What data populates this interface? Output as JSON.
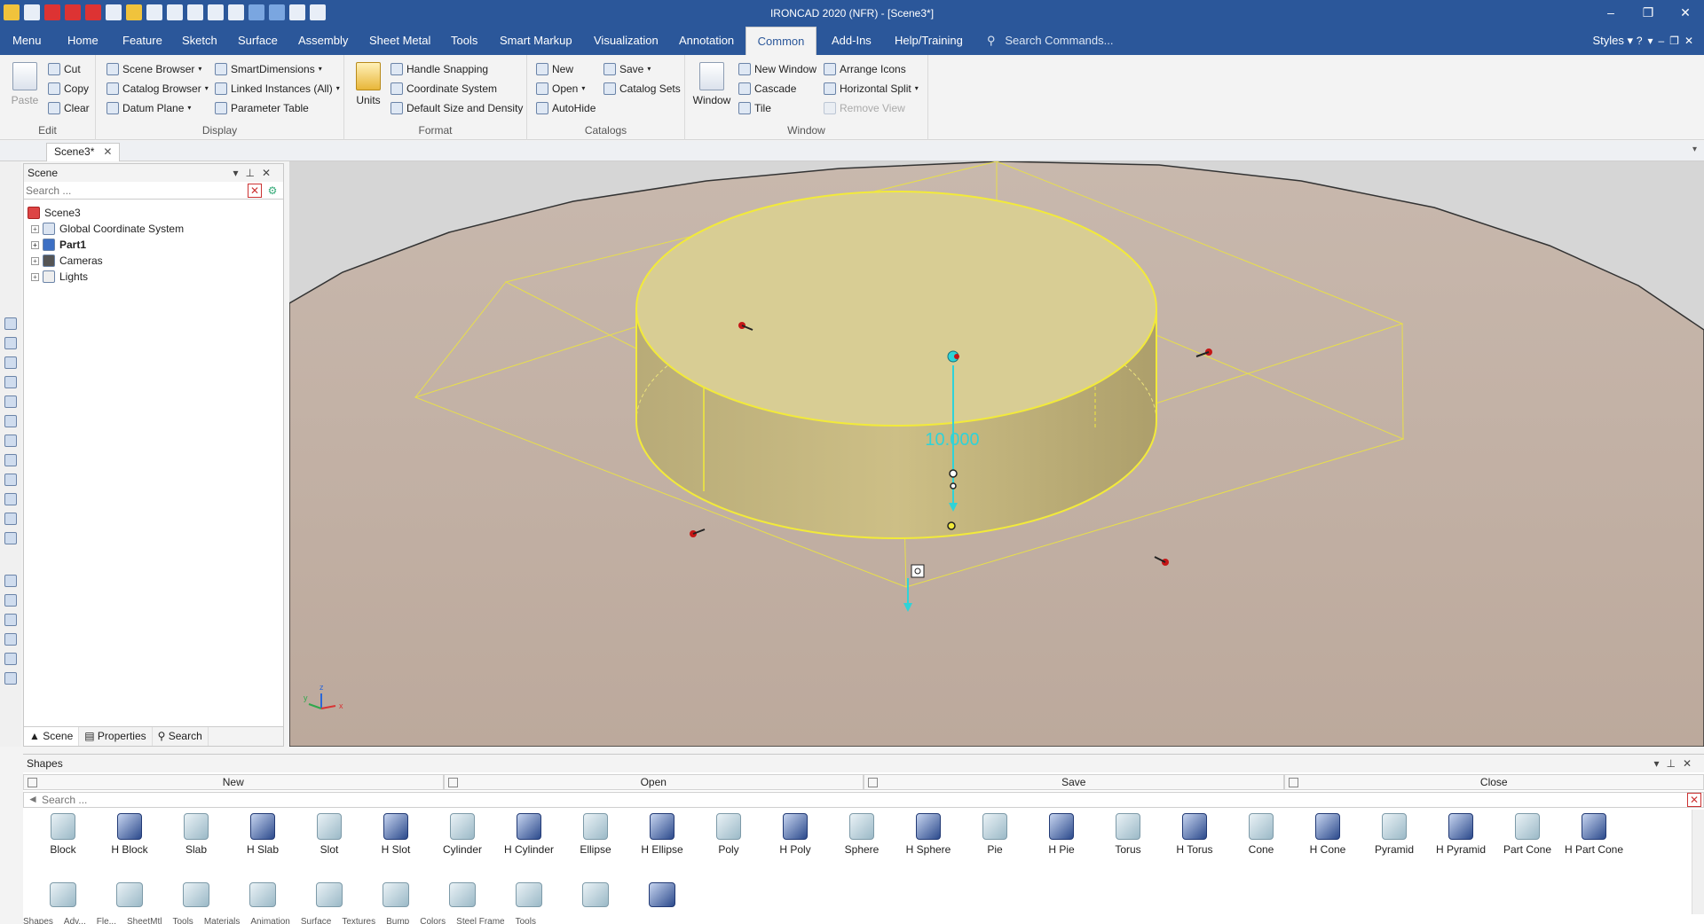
{
  "window": {
    "title": "IRONCAD 2020 (NFR) - [Scene3*]",
    "controls": [
      "–",
      "❐",
      "✕"
    ]
  },
  "ribbon_tabs": [
    "Menu",
    "Home",
    "Feature",
    "Sketch",
    "Surface",
    "Assembly",
    "Sheet Metal",
    "Tools",
    "Smart Markup",
    "Visualization",
    "Annotation",
    "Common",
    "Add-Ins",
    "Help/Training"
  ],
  "active_tab": "Common",
  "search_commands": {
    "placeholder": "Search Commands..."
  },
  "styles_label": "Styles",
  "ribbon": {
    "edit": {
      "label": "Edit",
      "paste": "Paste",
      "cut": "Cut",
      "copy": "Copy",
      "clear": "Clear"
    },
    "display": {
      "label": "Display",
      "scene_browser": "Scene Browser",
      "catalog_browser": "Catalog Browser",
      "datum_plane": "Datum Plane",
      "smart_dimensions": "SmartDimensions",
      "linked_instances": "Linked Instances (All)",
      "parameter_table": "Parameter Table"
    },
    "format": {
      "label": "Format",
      "units": "Units",
      "handle_snapping": "Handle Snapping",
      "coordinate_system": "Coordinate System",
      "default_size": "Default Size and Density"
    },
    "catalogs": {
      "label": "Catalogs",
      "new": "New",
      "open": "Open",
      "autohide": "AutoHide",
      "save": "Save",
      "catalog_sets": "Catalog Sets"
    },
    "window": {
      "label": "Window",
      "window": "Window",
      "new_window": "New Window",
      "cascade": "Cascade",
      "tile": "Tile",
      "arrange_icons": "Arrange Icons",
      "horizontal_split": "Horizontal Split",
      "remove_view": "Remove View"
    }
  },
  "doc_tab": "Scene3*",
  "scene_panel": {
    "title": "Scene",
    "search_placeholder": "Search ...",
    "tree": [
      {
        "label": "Scene3",
        "bold": false
      },
      {
        "label": "Global Coordinate System",
        "bold": false
      },
      {
        "label": "Part1",
        "bold": true
      },
      {
        "label": "Cameras",
        "bold": false
      },
      {
        "label": "Lights",
        "bold": false
      }
    ],
    "footer_tabs": [
      "Scene",
      "Properties",
      "Search"
    ]
  },
  "viewport": {
    "dimension_label": "10.000",
    "axis_labels": {
      "x": "x",
      "y": "y",
      "z": "z"
    },
    "colors": {
      "background": "#d6d6d6",
      "floor": "#c4b3a8",
      "part_fill": "#d8cd94",
      "highlight": "#f2ea3a",
      "dimension": "#2fd3d8"
    }
  },
  "shapes_panel": {
    "title": "Shapes",
    "buttons": [
      "New",
      "Open",
      "Save",
      "Close"
    ],
    "search_placeholder": "Search ...",
    "items": [
      "Block",
      "H Block",
      "Slab",
      "H Slab",
      "Slot",
      "H Slot",
      "Cylinder",
      "H Cylinder",
      "Ellipse",
      "H Ellipse",
      "Poly",
      "H Poly",
      "Sphere",
      "H Sphere",
      "Pie",
      "H Pie",
      "Torus",
      "H Torus",
      "Cone",
      "H Cone",
      "Pyramid",
      "H Pyramid",
      "Part Cone",
      "H Part Cone"
    ],
    "second_row_count": 10,
    "bottom_tabs": [
      "Shapes",
      "Adv...",
      "Fle...",
      "SheetMtl",
      "Tools",
      "Materials",
      "Animation",
      "Surface",
      "Textures",
      "Bump",
      "Colors",
      "Steel Frame",
      "Tools"
    ]
  }
}
